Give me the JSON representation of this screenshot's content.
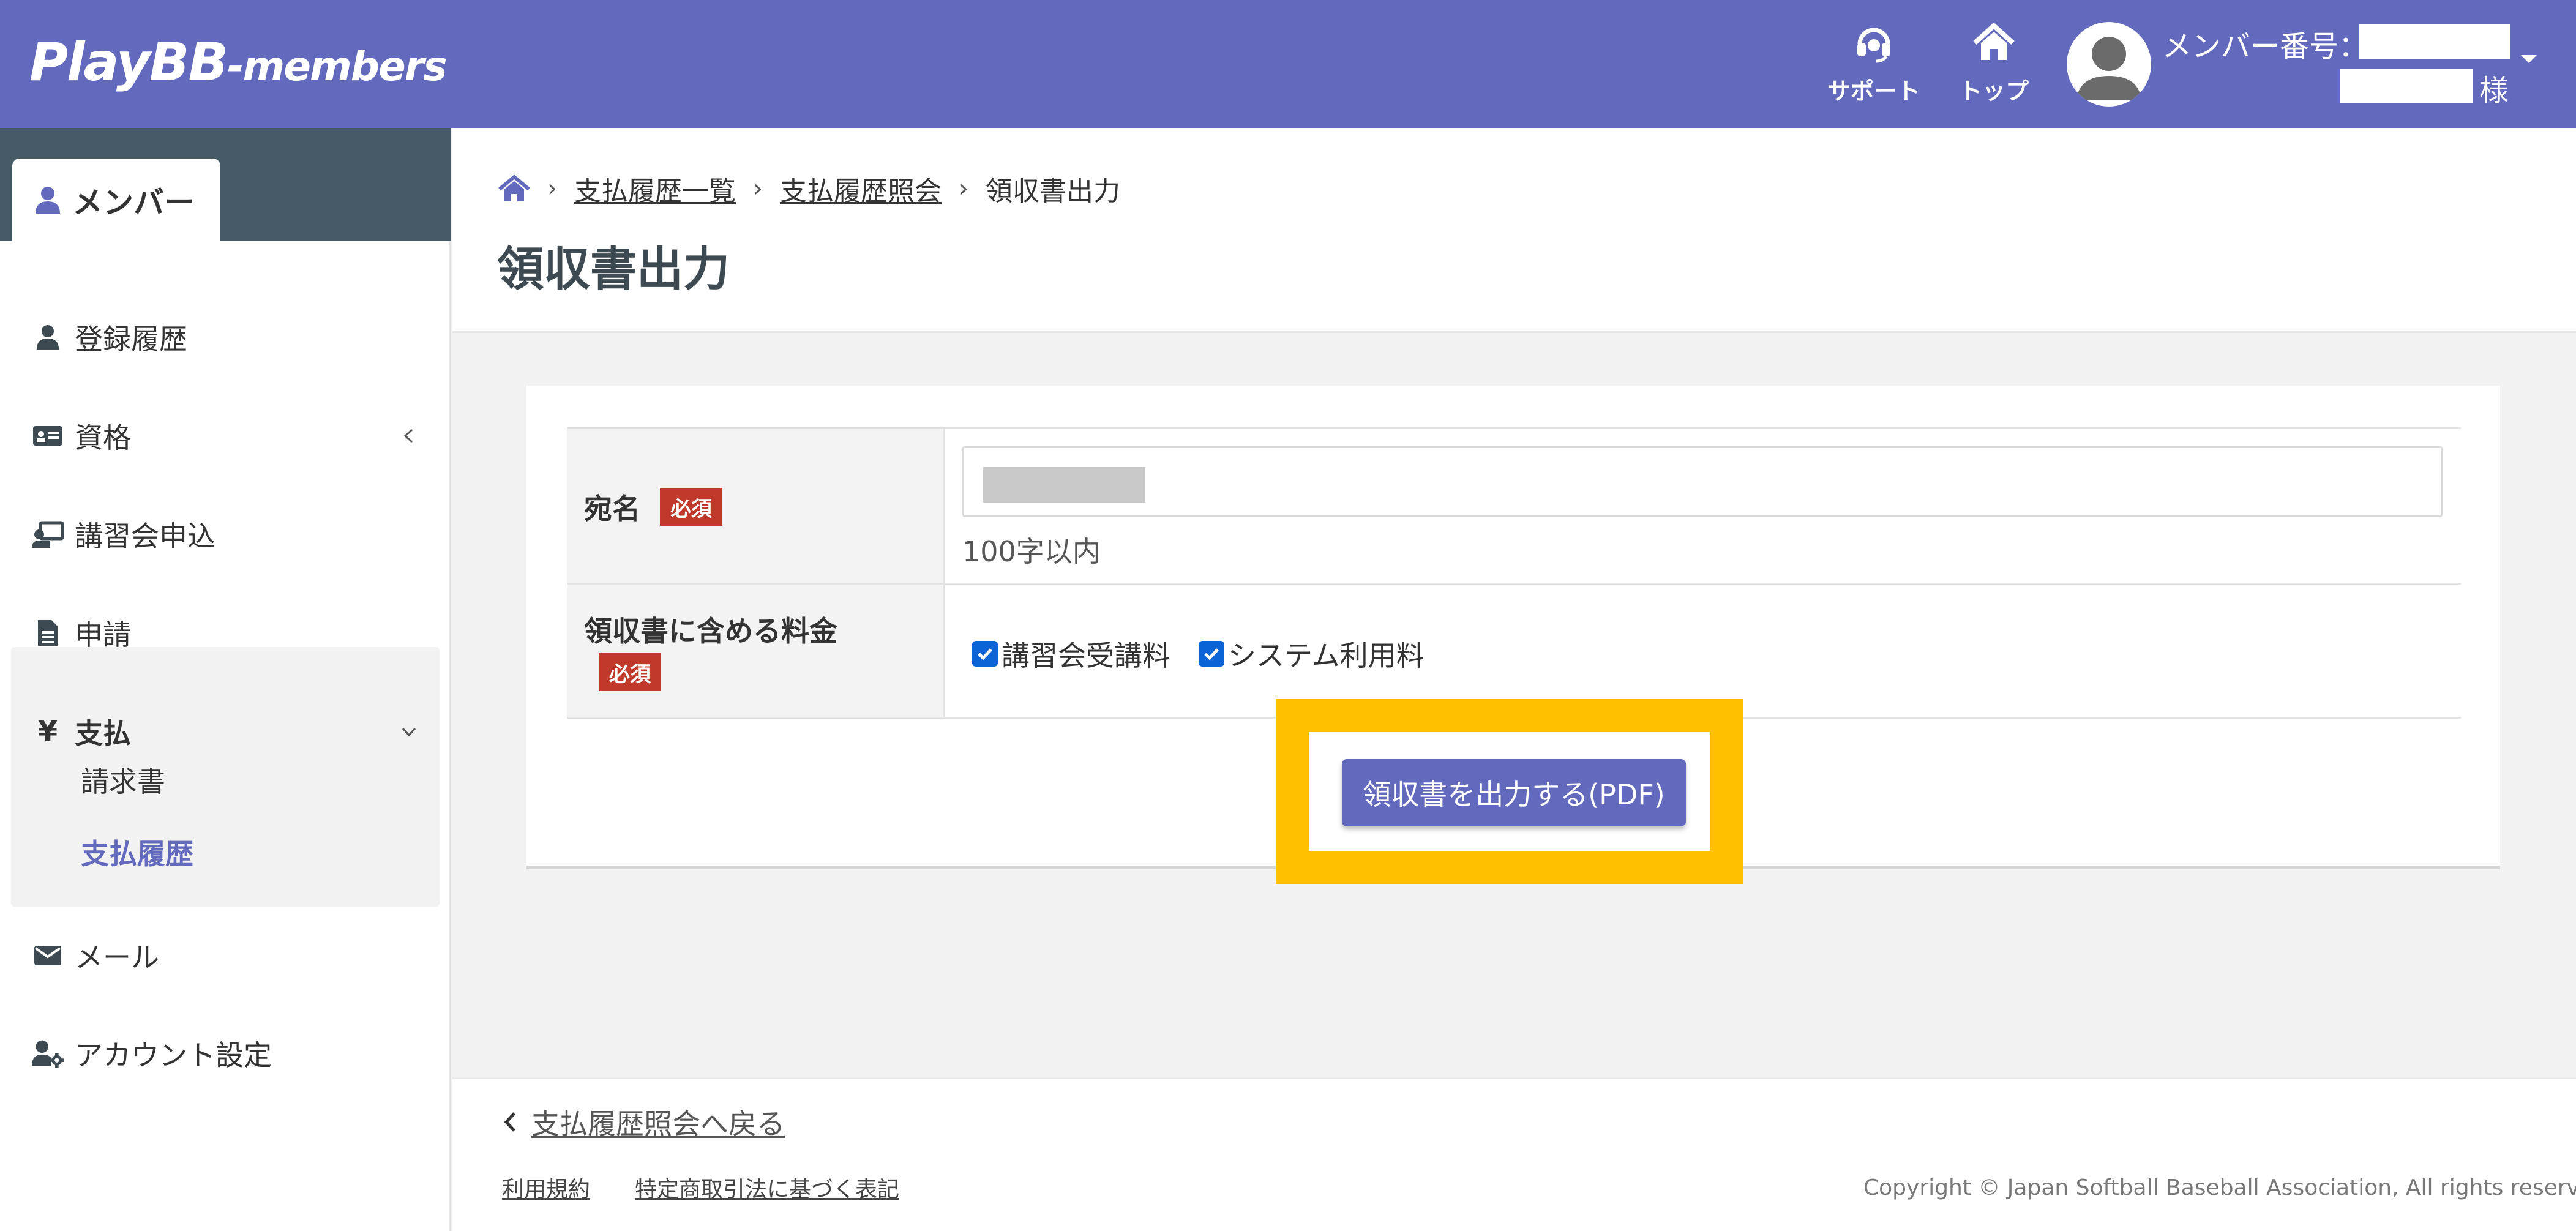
{
  "header": {
    "logo_main": "PlayBB",
    "logo_sub": "-members",
    "support_label": "サポート",
    "top_label": "トップ",
    "member_label": "メンバー番号：",
    "member_suffix": "様",
    "bg_color": "#6369bc"
  },
  "sidebar": {
    "tab_label": "メンバー",
    "items": [
      {
        "label": "登録履歴",
        "icon": "user-icon"
      },
      {
        "label": "資格",
        "icon": "id-card-icon"
      },
      {
        "label": "講習会申込",
        "icon": "chalkboard-icon"
      },
      {
        "label": "申請",
        "icon": "document-icon"
      },
      {
        "label": "支払",
        "icon": "yen-icon"
      },
      {
        "label": "メール",
        "icon": "envelope-icon"
      },
      {
        "label": "アカウント設定",
        "icon": "user-cog-icon"
      }
    ],
    "yen_symbol": "¥",
    "pay_sub": [
      {
        "label": "請求書"
      },
      {
        "label": "支払履歴"
      }
    ]
  },
  "breadcrumb": {
    "items": [
      "支払履歴一覧",
      "支払履歴照会",
      "領収書出力"
    ]
  },
  "page": {
    "title": "領収書出力"
  },
  "form": {
    "addressee_label": "宛名",
    "required_badge": "必須",
    "addressee_hint": "100字以内",
    "fees_label": "領収書に含める料金",
    "fee_options": [
      {
        "label": "講習会受講料",
        "checked": true
      },
      {
        "label": "システム利用料",
        "checked": true
      }
    ],
    "submit_label": "領収書を出力する(PDF)"
  },
  "footer": {
    "back_link": "支払履歴照会へ戻る",
    "terms_link": "利用規約",
    "commerce_link": "特定商取引法に基づく表記",
    "copyright": "Copyright © Japan Softball Baseball Association, All rights reserved."
  },
  "colors": {
    "accent": "#6369bc",
    "sidebar_dark": "#455a64",
    "required": "#c0392b",
    "highlight": "#ffc000",
    "checkbox": "#0b63d6"
  }
}
